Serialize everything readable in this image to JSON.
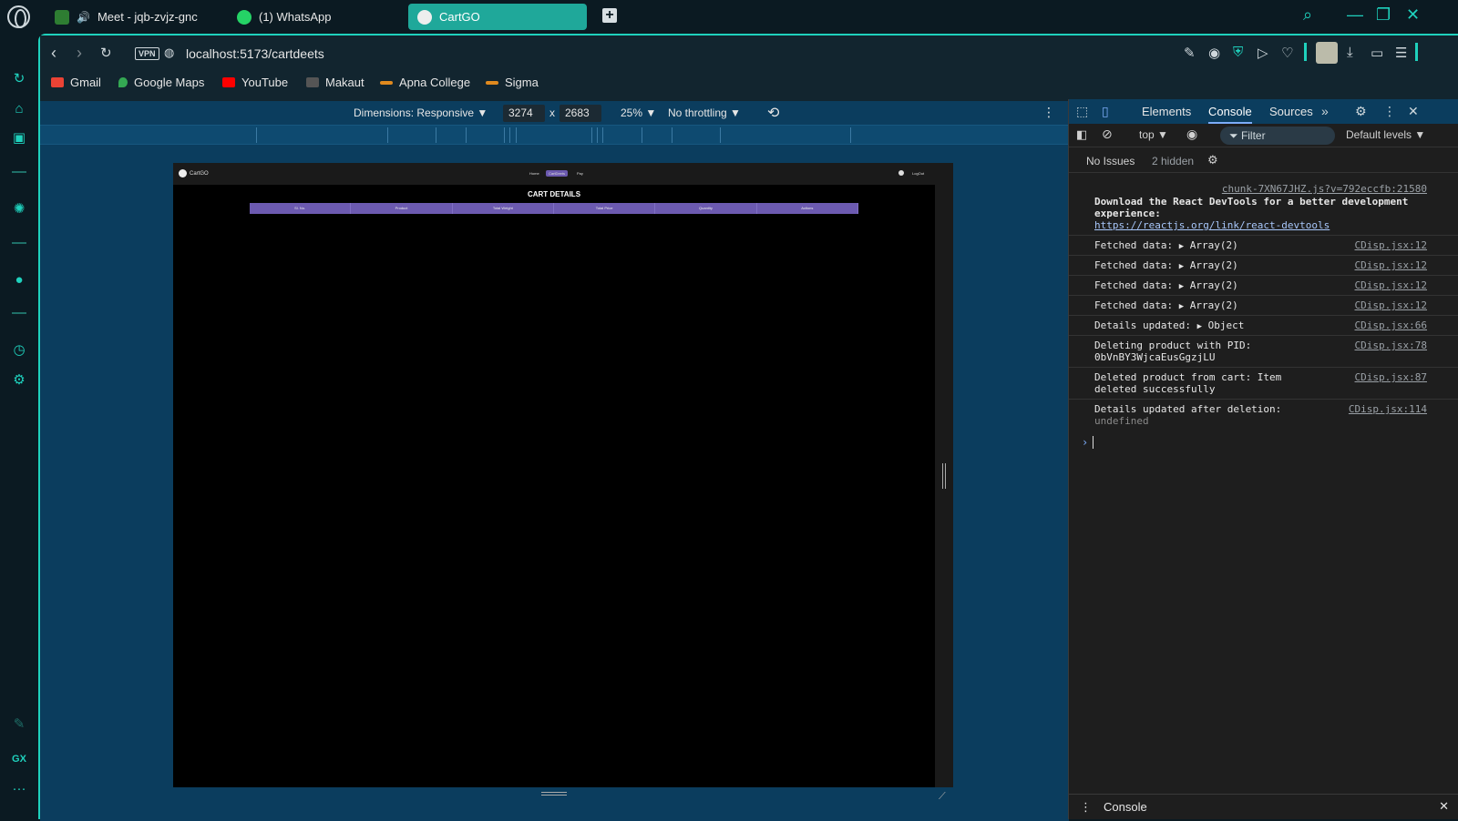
{
  "tabs": [
    {
      "label": "Meet - jqb-zvjz-gnc"
    },
    {
      "label": "(1) WhatsApp"
    },
    {
      "label": "CartGO"
    }
  ],
  "address": {
    "vpn": "VPN",
    "url": "localhost:5173/cartdeets"
  },
  "bookmarks": [
    {
      "label": "Gmail"
    },
    {
      "label": "Google Maps"
    },
    {
      "label": "YouTube"
    },
    {
      "label": "Makaut"
    },
    {
      "label": "Apna College"
    },
    {
      "label": "Sigma"
    }
  ],
  "device_toolbar": {
    "dimensions": "Dimensions: Responsive ▼",
    "width": "3274",
    "x": "x",
    "height": "2683",
    "zoom": "25% ▼",
    "throttle": "No throttling ▼"
  },
  "emulated_page": {
    "brand": "CartGO",
    "nav": [
      "Home",
      "CartDeets",
      "Pay"
    ],
    "logout": "LogOut",
    "title": "CART DETAILS",
    "columns": [
      "Sl. No.",
      "Product",
      "Total Weight",
      "Total Price",
      "Quantity",
      "Actions"
    ]
  },
  "devtools": {
    "tabs": [
      "Elements",
      "Console",
      "Sources"
    ],
    "context": "top ▼",
    "filter": "Filter",
    "levels": "Default levels ▼",
    "issues": "No Issues",
    "hidden": "2 hidden",
    "drawer": "Console",
    "messages": [
      {
        "src": "chunk-7XN67JHZ.js?v=792eccfb:21580",
        "text_bold": "Download the React DevTools for a better development experience:",
        "link": "https://reactjs.org/link/react-devtools"
      },
      {
        "src": "CDisp.jsx:12",
        "text": "Fetched data:",
        "obj": "Array(2)"
      },
      {
        "src": "CDisp.jsx:12",
        "text": "Fetched data:",
        "obj": "Array(2)"
      },
      {
        "src": "CDisp.jsx:12",
        "text": "Fetched data:",
        "obj": "Array(2)"
      },
      {
        "src": "CDisp.jsx:12",
        "text": "Fetched data:",
        "obj": "Array(2)"
      },
      {
        "src": "CDisp.jsx:66",
        "text": "Details updated:",
        "obj": "Object"
      },
      {
        "src": "CDisp.jsx:78",
        "text": "Deleting product with PID:",
        "text2": "0bVnBY3WjcaEusGgzjLU"
      },
      {
        "src": "CDisp.jsx:87",
        "text": "Deleted product from cart: Item",
        "text2": "deleted successfully"
      },
      {
        "src": "CDisp.jsx:114",
        "text": "Details updated after deletion:",
        "undef": "undefined"
      }
    ]
  },
  "colors": {
    "accent": "#1fd1bd",
    "tab_active": "#1fa89a",
    "table_header": "#6c5ab0"
  }
}
